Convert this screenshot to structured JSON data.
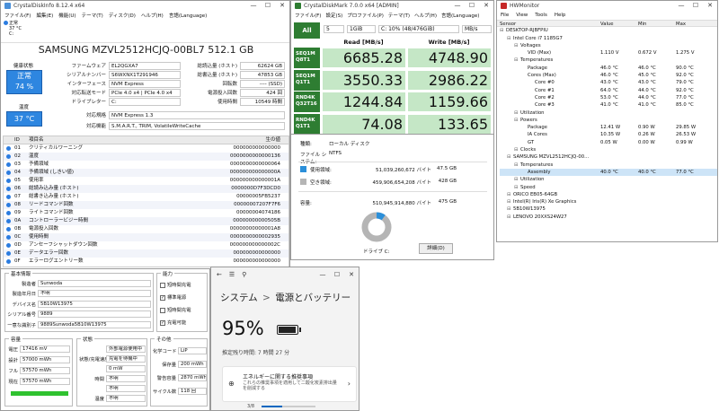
{
  "cdi": {
    "title": "CrystalDiskInfo 8.12.4 x64",
    "menu": [
      "ファイル(F)",
      "編集(E)",
      "機能(U)",
      "テーマ(T)",
      "ディスク(D)",
      "ヘルプ(H)",
      "言語(Language)"
    ],
    "drive_status": "正常",
    "drive_temp": "37 °C",
    "drive_letter": "C:",
    "model": "SAMSUNG MZVL2512HCJQ-00BL7 512.1 GB",
    "health_label": "健康状態",
    "health_status": "正常",
    "health_pct": "74 %",
    "temp_label": "温度",
    "temp": "37 °C",
    "left_fields": [
      {
        "label": "ファームウェア",
        "value": "EL2QGXA7"
      },
      {
        "label": "シリアルナンバー",
        "value": "S6WXNX1T291946"
      },
      {
        "label": "インターフェース",
        "value": "NVM Express"
      },
      {
        "label": "対応転送モード",
        "value": "PCIe 4.0 x4 | PCIe 4.0 x4"
      },
      {
        "label": "ドライブレター",
        "value": "C:"
      }
    ],
    "right_fields": [
      {
        "label": "総読込量 (ホスト)",
        "value": "62624 GB"
      },
      {
        "label": "総書込量 (ホスト)",
        "value": "47853 GB"
      },
      {
        "label": "回転数",
        "value": "---- (SSD)"
      },
      {
        "label": "電源投入回数",
        "value": "424 回"
      },
      {
        "label": "使用時間",
        "value": "10549 時間"
      }
    ],
    "standard_label": "対応規格",
    "standard": "NVM Express 1.3",
    "features_label": "対応機能",
    "features": "S.M.A.R.T., TRIM, VolatileWriteCache",
    "smart_headers": [
      "ID",
      "項目名",
      "生の値"
    ],
    "smart_rows": [
      [
        "01",
        "クリティカルワーニング",
        "000000000000000"
      ],
      [
        "02",
        "温度",
        "0000000000000136"
      ],
      [
        "03",
        "予備領域",
        "0000000000000064"
      ],
      [
        "04",
        "予備領域 (しきい値)",
        "000000000000000A"
      ],
      [
        "05",
        "使用率",
        "000000000000001A"
      ],
      [
        "06",
        "総読み込み量 (ホスト)",
        "0000000D7F3DCD0"
      ],
      [
        "07",
        "総書き込み量 (ホスト)",
        "00000005FB5237"
      ],
      [
        "08",
        "リードコマンド回数",
        "00000007207F7F6"
      ],
      [
        "09",
        "ライトコマンド回数",
        "00000004074186"
      ],
      [
        "0A",
        "コントローラービジー時間",
        "00000000000505B"
      ],
      [
        "0B",
        "電源投入回数",
        "00000000000001A8"
      ],
      [
        "0C",
        "使用時間",
        "0000000000002935"
      ],
      [
        "0D",
        "アンセーフシャットダウン回数",
        "000000000000002C"
      ],
      [
        "0E",
        "データエラー回数",
        "000000000000000"
      ],
      [
        "0F",
        "エラーログエントリー数",
        "000000000000000"
      ]
    ]
  },
  "battery": {
    "basic_title": "基本情報",
    "basic": [
      {
        "label": "製造者",
        "value": "Sunwoda"
      },
      {
        "label": "製造年月日",
        "value": "不明"
      },
      {
        "label": "デバイス名",
        "value": "5B10W13975"
      },
      {
        "label": "シリアル番号",
        "value": "9889"
      },
      {
        "label": "一意な識別子",
        "value": "9889Sunwoda5B10W13975"
      }
    ],
    "ability_title": "能力",
    "ability": [
      {
        "label": "短時間充電",
        "checked": false
      },
      {
        "label": "標準電源",
        "checked": true
      },
      {
        "label": "短時間充電",
        "checked": false
      },
      {
        "label": "充電可能",
        "checked": true
      }
    ],
    "capacity_title": "容量",
    "capacity": [
      {
        "label": "電圧",
        "value": "17416 mV"
      },
      {
        "label": "設計",
        "value": "57000 mWh"
      },
      {
        "label": "フル",
        "value": "57570 mWh"
      },
      {
        "label": "現在",
        "value": "57570 mWh"
      }
    ],
    "capacity_fill": 1.0,
    "state_title": "状態",
    "state": [
      {
        "label": "",
        "value": "外部電源使用中"
      },
      {
        "label": "状態/充電速度",
        "value": "充電を待機中"
      },
      {
        "label": "",
        "value": "0 mW"
      },
      {
        "label": "時間",
        "value": "不明"
      },
      {
        "label": "",
        "value": "不明"
      },
      {
        "label": "温度",
        "value": "不明"
      }
    ],
    "other_title": "その他",
    "other": [
      {
        "label": "化学コード",
        "value": "LiP"
      },
      {
        "label": "保存量",
        "value": "200 mWh"
      },
      {
        "label": "警告容量",
        "value": "2870 mWh"
      },
      {
        "label": "サイクル数",
        "value": "118 回"
      }
    ]
  },
  "cdm": {
    "title": "CrystalDiskMark 7.0.0 x64 [ADMIN]",
    "menu": [
      "ファイル(F)",
      "設定(S)",
      "プロファイル(P)",
      "テーマ(T)",
      "ヘルプ(H)",
      "言語(Language)"
    ],
    "all_label": "All",
    "count": "5",
    "size": "1GiB",
    "drive": "C: 10% (48/476GiB)",
    "unit": "MB/s",
    "read_header": "Read [MB/s]",
    "write_header": "Write [MB/s]",
    "tests": [
      {
        "l1": "SEQ1M",
        "l2": "Q8T1",
        "read": "6685.28",
        "write": "4748.90"
      },
      {
        "l1": "SEQ1M",
        "l2": "Q1T1",
        "read": "3550.33",
        "write": "2986.22"
      },
      {
        "l1": "RND4K",
        "l2": "Q32T16",
        "read": "1244.84",
        "write": "1159.66"
      },
      {
        "l1": "RND4K",
        "l2": "Q1T1",
        "read": "74.08",
        "write": "133.65"
      }
    ]
  },
  "props": {
    "type_label": "種類:",
    "type": "ローカル ディスク",
    "fs_label": "ファイル システム:",
    "fs": "NTFS",
    "used_label": "使用領域:",
    "used_bytes": "51,039,260,672 バイト",
    "used_gb": "47.5 GB",
    "free_label": "空き領域:",
    "free_bytes": "459,906,654,208 バイト",
    "free_gb": "428 GB",
    "cap_label": "容量:",
    "cap_bytes": "510,945,914,880 バイト",
    "cap_gb": "475 GB",
    "used_fraction": 0.1,
    "drive_label": "ドライブ C:",
    "detail_button": "詳細(D)"
  },
  "settings": {
    "breadcrumb_parent": "システム",
    "breadcrumb_sep": ">",
    "page_title": "電源とバッテリー",
    "percent": "95%",
    "remaining": "推定残り時間: 7 時間 27 分",
    "rec_title": "エネルギーに関する推奨事項",
    "rec_desc": "これらの推奨事項を適用して二酸化炭素排出量を削減する",
    "rec_count": "3/8",
    "level": 0.95
  },
  "hwm": {
    "title": "HWMonitor",
    "menu": [
      "File",
      "View",
      "Tools",
      "Help"
    ],
    "headers": [
      "Sensor",
      "Value",
      "Min",
      "Max"
    ],
    "rows": [
      {
        "indent": 0,
        "name": "DESKTOP-RJBFPIU",
        "v": "",
        "mn": "",
        "mx": ""
      },
      {
        "indent": 1,
        "name": "Intel Core i7 1185G7",
        "v": "",
        "mn": "",
        "mx": ""
      },
      {
        "indent": 2,
        "name": "Voltages",
        "v": "",
        "mn": "",
        "mx": ""
      },
      {
        "indent": 3,
        "name": "VID (Max)",
        "v": "1.110 V",
        "mn": "0.672 V",
        "mx": "1.275 V"
      },
      {
        "indent": 2,
        "name": "Temperatures",
        "v": "",
        "mn": "",
        "mx": ""
      },
      {
        "indent": 3,
        "name": "Package",
        "v": "46.0 °C",
        "mn": "46.0 °C",
        "mx": "90.0 °C"
      },
      {
        "indent": 3,
        "name": "Cores (Max)",
        "v": "46.0 °C",
        "mn": "45.0 °C",
        "mx": "92.0 °C"
      },
      {
        "indent": 4,
        "name": "Core #0",
        "v": "43.0 °C",
        "mn": "43.0 °C",
        "mx": "79.0 °C"
      },
      {
        "indent": 4,
        "name": "Core #1",
        "v": "64.0 °C",
        "mn": "44.0 °C",
        "mx": "92.0 °C"
      },
      {
        "indent": 4,
        "name": "Core #2",
        "v": "53.0 °C",
        "mn": "44.0 °C",
        "mx": "77.0 °C"
      },
      {
        "indent": 4,
        "name": "Core #3",
        "v": "41.0 °C",
        "mn": "41.0 °C",
        "mx": "85.0 °C"
      },
      {
        "indent": 2,
        "name": "Utilization",
        "v": "",
        "mn": "",
        "mx": ""
      },
      {
        "indent": 2,
        "name": "Powers",
        "v": "",
        "mn": "",
        "mx": ""
      },
      {
        "indent": 3,
        "name": "Package",
        "v": "12.41 W",
        "mn": "0.90 W",
        "mx": "29.85 W"
      },
      {
        "indent": 3,
        "name": "IA Cores",
        "v": "10.35 W",
        "mn": "0.26 W",
        "mx": "26.53 W"
      },
      {
        "indent": 3,
        "name": "GT",
        "v": "0.05 W",
        "mn": "0.00 W",
        "mx": "0.99 W"
      },
      {
        "indent": 2,
        "name": "Clocks",
        "v": "",
        "mn": "",
        "mx": ""
      },
      {
        "indent": 1,
        "name": "SAMSUNG MZVL2512HCJQ-00...",
        "v": "",
        "mn": "",
        "mx": ""
      },
      {
        "indent": 2,
        "name": "Temperatures",
        "v": "",
        "mn": "",
        "mx": ""
      },
      {
        "indent": 3,
        "name": "Assembly",
        "v": "40.0 °C",
        "mn": "40.0 °C",
        "mx": "77.0 °C"
      },
      {
        "indent": 2,
        "name": "Utilization",
        "v": "",
        "mn": "",
        "mx": ""
      },
      {
        "indent": 2,
        "name": "Speed",
        "v": "",
        "mn": "",
        "mx": ""
      },
      {
        "indent": 1,
        "name": "ORICO EB05-64GB",
        "v": "",
        "mn": "",
        "mx": ""
      },
      {
        "indent": 1,
        "name": "Intel(R) Iris(R) Xe Graphics",
        "v": "",
        "mn": "",
        "mx": ""
      },
      {
        "indent": 1,
        "name": "5B10W13975",
        "v": "",
        "mn": "",
        "mx": ""
      },
      {
        "indent": 1,
        "name": "LENOVO 20XXS24W27",
        "v": "",
        "mn": "",
        "mx": ""
      }
    ]
  },
  "colors": {
    "accent_blue": "#2b7ce0",
    "cdm_green": "#2e7d32",
    "cdm_cell": "#c5e7c6",
    "settings_accent": "#0067c0"
  }
}
